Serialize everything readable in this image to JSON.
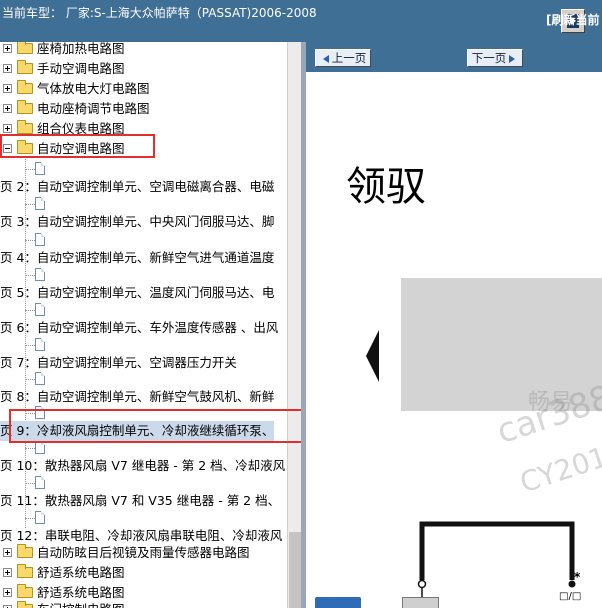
{
  "header": {
    "title": "当前车型： 厂家:S-上海大众帕萨特（PASSAT)2006-2008"
  },
  "tree": {
    "items": [
      {
        "label": "座椅加热电路图"
      },
      {
        "label": "手动空调电路图"
      },
      {
        "label": "气体放电大灯电路图"
      },
      {
        "label": "电动座椅调节电路图"
      },
      {
        "label": "组合仪表电路图"
      },
      {
        "label": "自动空调电路图"
      },
      {
        "label": "页 2：自动空调控制单元、空调电磁离合器、电磁"
      },
      {
        "label": "页 3：自动空调控制单元、中央风门伺服马达、脚"
      },
      {
        "label": "页 4：自动空调控制单元、新鲜空气进气通道温度"
      },
      {
        "label": "页 5：自动空调控制单元、温度风门伺服马达、电"
      },
      {
        "label": "页 6：自动空调控制单元、车外温度传感器 、出风"
      },
      {
        "label": "页 7：自动空调控制单元、空调器压力开关"
      },
      {
        "label": "页 8：自动空调控制单元、新鲜空气鼓风机、新鲜"
      },
      {
        "label": "页 9：冷却液风扇控制单元、冷却液继续循环泵、"
      },
      {
        "label": "页 10：散热器风扇 V7 继电器 - 第 2 档、冷却液风"
      },
      {
        "label": "页 11：散热器风扇 V7 和 V35 继电器 - 第 2 档、"
      },
      {
        "label": "页 12：串联电阻、冷却液风扇串联电阻、冷却液风"
      },
      {
        "label": "自动防眩目后视镜及雨量传感器电路图"
      },
      {
        "label": "舒适系统电路图"
      },
      {
        "label": "舒适系统电路图"
      },
      {
        "label": "车门控制电路图"
      }
    ]
  },
  "toolbar": {
    "prev_label": "上一页",
    "next_label": "下一页",
    "refresh_label": "[刷新当前"
  },
  "document": {
    "heading": "领驭",
    "watermark_line1": "畅易",
    "watermark_line2": "car388.c",
    "watermark_line3": "CY201",
    "pin_label": "□/□",
    "star": "*"
  }
}
